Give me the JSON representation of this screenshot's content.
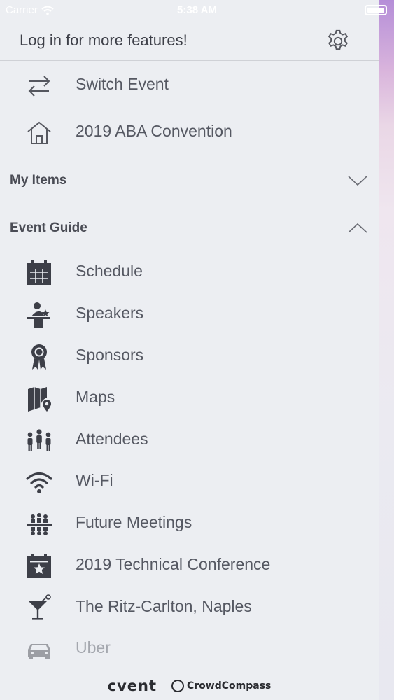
{
  "status_bar": {
    "carrier": "Carrier",
    "time": "5:38 AM"
  },
  "header": {
    "login_text": "Log in for more features!"
  },
  "top_items": [
    {
      "label": "Switch Event",
      "icon": "switch-arrows-icon"
    },
    {
      "label": "2019 ABA Convention",
      "icon": "home-icon"
    }
  ],
  "sections": {
    "my_items": {
      "title": "My Items",
      "state": "collapsed"
    },
    "event_guide": {
      "title": "Event Guide",
      "state": "expanded"
    }
  },
  "event_guide_items": [
    {
      "label": "Schedule",
      "icon": "calendar-icon"
    },
    {
      "label": "Speakers",
      "icon": "speaker-podium-icon"
    },
    {
      "label": "Sponsors",
      "icon": "ribbon-award-icon"
    },
    {
      "label": "Maps",
      "icon": "map-pin-icon"
    },
    {
      "label": "Attendees",
      "icon": "people-group-icon"
    },
    {
      "label": "Wi-Fi",
      "icon": "wifi-icon"
    },
    {
      "label": "Future Meetings",
      "icon": "meeting-table-icon"
    },
    {
      "label": "2019 Technical Conference",
      "icon": "calendar-star-icon"
    },
    {
      "label": "The Ritz-Carlton, Naples",
      "icon": "cocktail-icon"
    },
    {
      "label": "Uber",
      "icon": "car-icon"
    }
  ],
  "footer": {
    "brand1": "cvent",
    "brand2": "CrowdCompass"
  }
}
